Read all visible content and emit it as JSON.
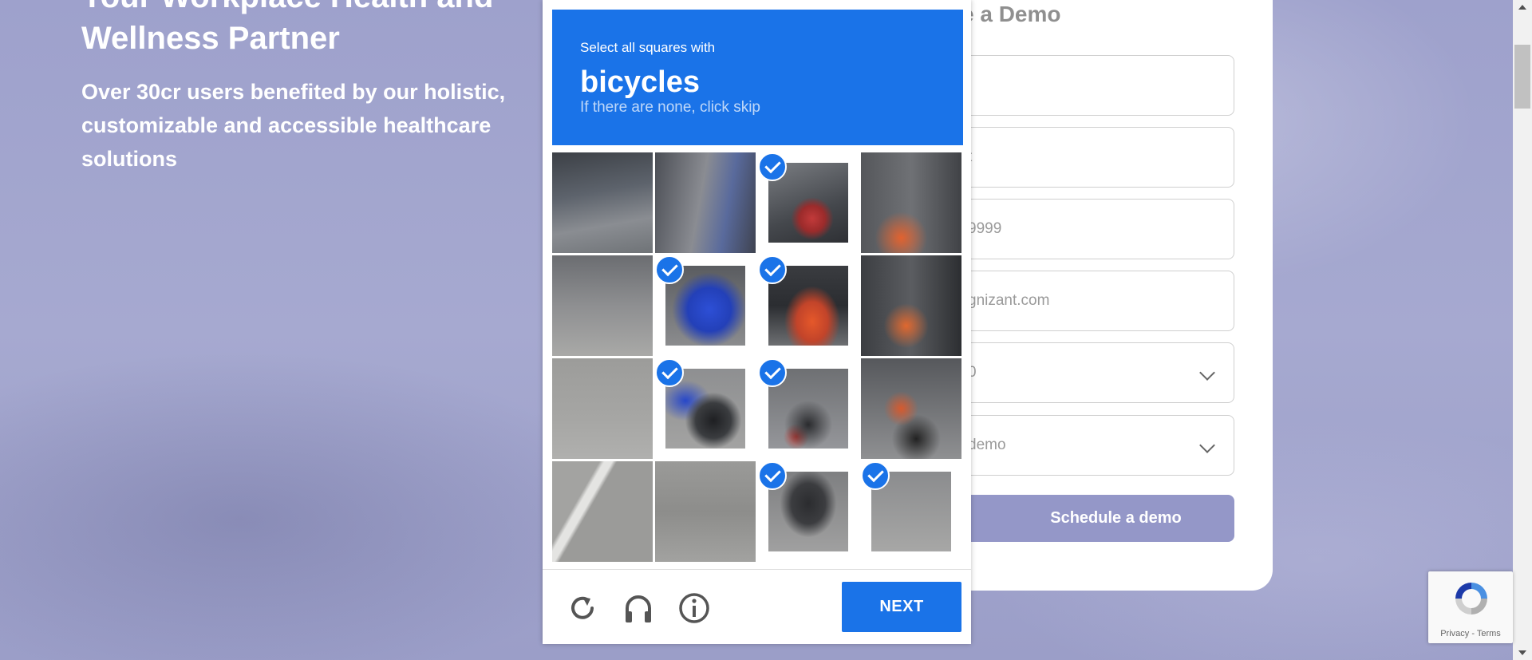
{
  "page": {
    "hero_title": "Your Workplace Health and Wellness Partner",
    "hero_subtitle": "Over 30cr users benefited by our holistic, customizable and accessible healthcare solutions"
  },
  "form": {
    "heading": "e a Demo",
    "fields": [
      {
        "value": "",
        "kind": "text"
      },
      {
        "value": "t",
        "kind": "text"
      },
      {
        "value": "9999",
        "kind": "text"
      },
      {
        "value": "gnizant.com",
        "kind": "text"
      },
      {
        "value": "0",
        "kind": "select"
      },
      {
        "value": "demo",
        "kind": "select"
      }
    ],
    "submit_label": "Schedule a demo"
  },
  "captcha": {
    "instruction": "Select all squares with",
    "target": "bicycles",
    "hint": "If there are none, click skip",
    "accent_color": "#1a73e8",
    "tiles": [
      {
        "selected": false
      },
      {
        "selected": false
      },
      {
        "selected": true
      },
      {
        "selected": false
      },
      {
        "selected": false
      },
      {
        "selected": true
      },
      {
        "selected": true
      },
      {
        "selected": false
      },
      {
        "selected": false
      },
      {
        "selected": true
      },
      {
        "selected": true
      },
      {
        "selected": false
      },
      {
        "selected": false
      },
      {
        "selected": false
      },
      {
        "selected": true
      },
      {
        "selected": true
      }
    ],
    "footer_icons": [
      "reload-icon",
      "headphones-icon",
      "info-icon"
    ],
    "next_label": "NEXT"
  },
  "recaptcha_badge": {
    "links": "Privacy - Terms"
  }
}
